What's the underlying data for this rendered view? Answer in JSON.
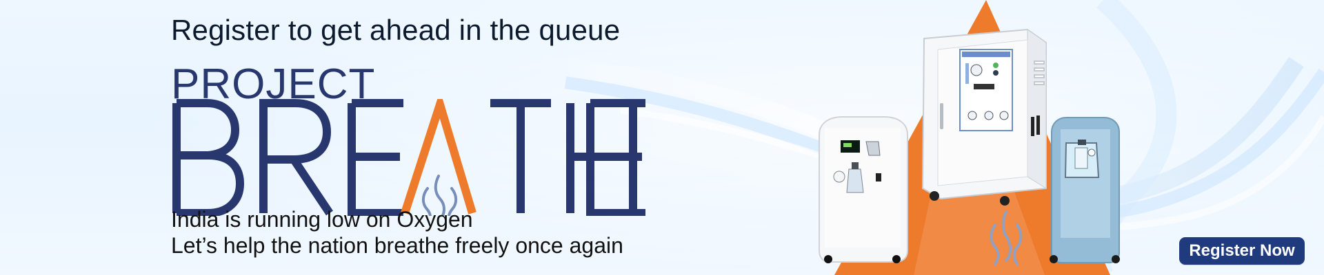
{
  "banner": {
    "tagline": "Register to get ahead in the queue",
    "logo": {
      "project": "PROJECT",
      "breathe": "BREATHE",
      "brand_color": "#28376E",
      "accent_color": "#EE7A2B",
      "mark_icon": "airflow-icon"
    },
    "lines": [
      "India is running low on Oxygen",
      "Let’s help the nation breathe freely once again"
    ],
    "cta": {
      "label": "Register Now",
      "color": "#1F3A7D"
    },
    "background_color": "#EAF5FF",
    "images": [
      "oxygen-concentrator-white-icon",
      "oxygen-generator-cabinet-icon",
      "oxygen-concentrator-blue-icon"
    ]
  }
}
